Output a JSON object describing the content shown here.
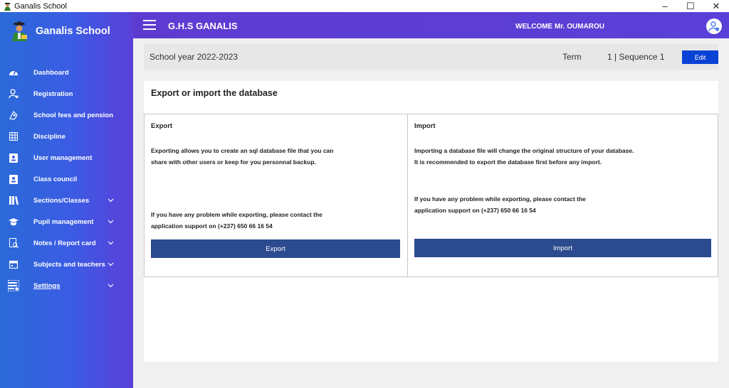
{
  "window": {
    "title": "Ganalis School",
    "controls": {
      "minimize": "–",
      "maximize": "☐",
      "close": "✕"
    }
  },
  "sidebar": {
    "brand": "Ganalis School",
    "items": [
      {
        "label": "Dashboard",
        "icon": "speedometer-icon",
        "has_submenu": false
      },
      {
        "label": "Registration",
        "icon": "add-user-icon",
        "has_submenu": false
      },
      {
        "label": "School fees and pension",
        "icon": "money-icon",
        "has_submenu": false
      },
      {
        "label": "Discipline",
        "icon": "calendar-grid-icon",
        "has_submenu": false
      },
      {
        "label": "User management",
        "icon": "id-card-icon",
        "has_submenu": false
      },
      {
        "label": "Class council",
        "icon": "id-card-icon",
        "has_submenu": false
      },
      {
        "label": "Sections/Classes",
        "icon": "library-icon",
        "has_submenu": true
      },
      {
        "label": "Pupil management",
        "icon": "graduation-cap-icon",
        "has_submenu": true
      },
      {
        "label": "Notes / Report card",
        "icon": "report-search-icon",
        "has_submenu": true
      },
      {
        "label": "Subjects and teachers",
        "icon": "calendar-icon",
        "has_submenu": true
      },
      {
        "label": "Settings",
        "icon": "settings-list-icon",
        "has_submenu": true,
        "active": true
      }
    ]
  },
  "header": {
    "school_name": "G.H.S GANALIS",
    "welcome": "WELCOME  Mr.  OUMAROU"
  },
  "yearbar": {
    "school_year": "School year 2022-2023",
    "term_label": "Term",
    "term_sequence": "1 | Sequence   1",
    "edit_label": "Edit"
  },
  "main": {
    "title": "Export or import the database",
    "export": {
      "title": "Export",
      "desc_line1": "Exporting allows you to create an sql database file that you can",
      "desc_line2": "share with other users or keep for you personnal backup.",
      "support_line1": "If you have any problem while exporting, please contact the",
      "support_line2": "application support on (+237) 650 66 16 54",
      "button": "Export"
    },
    "import": {
      "title": "Import",
      "desc_line1": "Importing a database file will change the original structure of your database.",
      "desc_line2": "It is recommended to export the database first before any import.",
      "support_line1": "If you have any problem while exporting, please contact the",
      "support_line2": "application support on (+237) 650 66 16 54",
      "button": "Import"
    }
  },
  "colors": {
    "sidebar_start": "#2a6ad8",
    "sidebar_end": "#5a3fd8",
    "header": "#5b3ed6",
    "edit_button": "#0b42d6",
    "action_button": "#2c4b8e"
  }
}
